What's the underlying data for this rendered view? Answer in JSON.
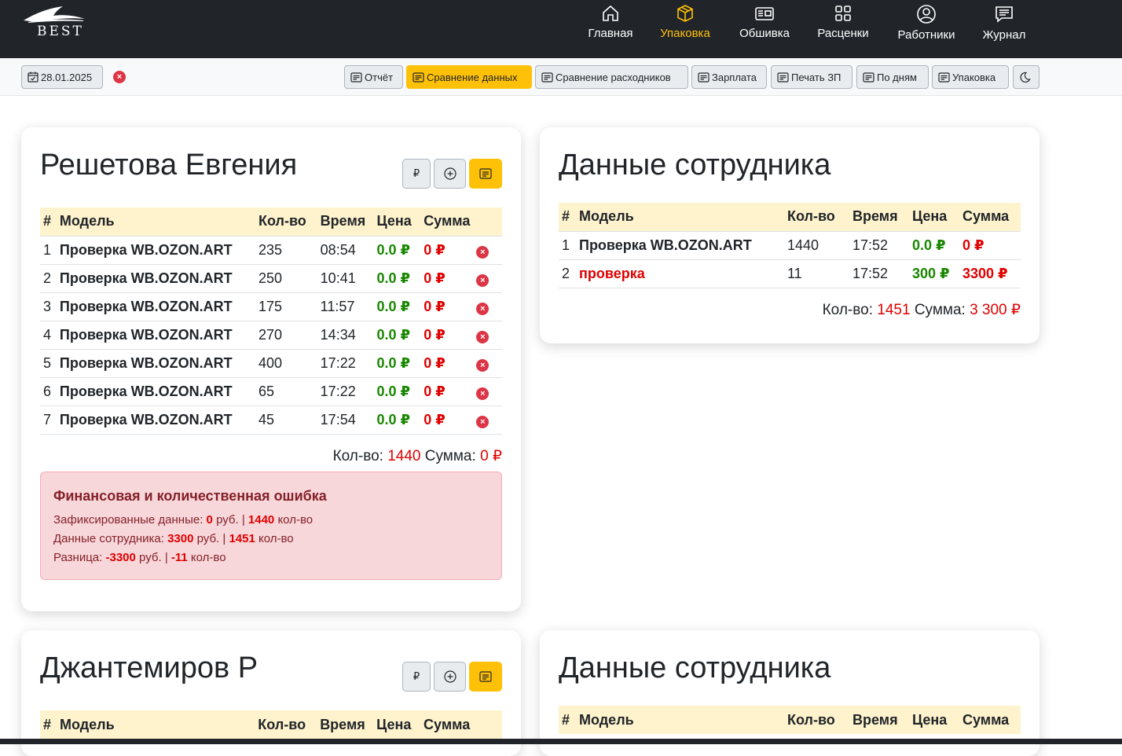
{
  "app": {
    "logo_text": "BEST"
  },
  "nav": [
    {
      "label": "Главная",
      "icon": "home-icon"
    },
    {
      "label": "Упаковка",
      "icon": "box-icon",
      "active": true
    },
    {
      "label": "Обшивка",
      "icon": "news-icon"
    },
    {
      "label": "Расценки",
      "icon": "grid-icon"
    },
    {
      "label": "Работники",
      "icon": "person-icon"
    },
    {
      "label": "Журнал",
      "icon": "journal-icon"
    }
  ],
  "toolbar": {
    "date": "28.01.2025",
    "buttons": [
      "Отчёт",
      "Сравнение данных",
      "Сравнение расходников",
      "Зарплата",
      "Печать ЗП",
      "По дням",
      "Упаковка"
    ],
    "active_button": "Сравнение данных"
  },
  "colors": {
    "accent": "#ffc107",
    "dark": "#212529",
    "green": "#198700",
    "red": "#e00000"
  },
  "cards": [
    {
      "title": "Решетова Евгения",
      "buttons": {
        "ruble": "₽"
      },
      "headers": [
        "#",
        "Модель",
        "Кол-во",
        "Время",
        "Цена",
        "Сумма"
      ],
      "rows": [
        {
          "n": "1",
          "model": "Проверка WB.OZON.ART",
          "qty": "235",
          "time": "08:54",
          "price": "0.0 ₽",
          "sum": "0 ₽"
        },
        {
          "n": "2",
          "model": "Проверка WB.OZON.ART",
          "qty": "250",
          "time": "10:41",
          "price": "0.0 ₽",
          "sum": "0 ₽"
        },
        {
          "n": "3",
          "model": "Проверка WB.OZON.ART",
          "qty": "175",
          "time": "11:57",
          "price": "0.0 ₽",
          "sum": "0 ₽"
        },
        {
          "n": "4",
          "model": "Проверка WB.OZON.ART",
          "qty": "270",
          "time": "14:34",
          "price": "0.0 ₽",
          "sum": "0 ₽"
        },
        {
          "n": "5",
          "model": "Проверка WB.OZON.ART",
          "qty": "400",
          "time": "17:22",
          "price": "0.0 ₽",
          "sum": "0 ₽"
        },
        {
          "n": "6",
          "model": "Проверка WB.OZON.ART",
          "qty": "65",
          "time": "17:22",
          "price": "0.0 ₽",
          "sum": "0 ₽"
        },
        {
          "n": "7",
          "model": "Проверка WB.OZON.ART",
          "qty": "45",
          "time": "17:54",
          "price": "0.0 ₽",
          "sum": "0 ₽"
        }
      ],
      "summary": {
        "qty_label": "Кол-во:",
        "qty": "1440",
        "sum_label": "Сумма:",
        "sum": "0 ₽"
      },
      "alert": {
        "title": "Финансовая и количественная ошибка",
        "line1": {
          "label": "Зафиксированные данные:",
          "money": "0",
          "money_unit": "руб. |",
          "qty": "1440",
          "qty_unit": "кол-во"
        },
        "line2": {
          "label": "Данные сотрудника:",
          "money": "3300",
          "money_unit": "руб. |",
          "qty": "1451",
          "qty_unit": "кол-во"
        },
        "line3": {
          "label": "Разница:",
          "money": "-3300",
          "money_unit": "руб. |",
          "qty": "-11",
          "qty_unit": "кол-во"
        }
      }
    },
    {
      "title": "Данные сотрудника",
      "headers": [
        "#",
        "Модель",
        "Кол-во",
        "Время",
        "Цена",
        "Сумма"
      ],
      "rows": [
        {
          "n": "1",
          "model": "Проверка WB.OZON.ART",
          "qty": "1440",
          "time": "17:52",
          "price": "0.0 ₽",
          "sum": "0 ₽"
        },
        {
          "n": "2",
          "model": "проверка",
          "qty": "11",
          "time": "17:52",
          "price": "300 ₽",
          "sum": "3300 ₽"
        }
      ],
      "summary": {
        "qty_label": "Кол-во:",
        "qty": "1451",
        "sum_label": "Сумма:",
        "sum": "3 300 ₽"
      }
    },
    {
      "title": "Джантемиров Р",
      "buttons": {
        "ruble": "₽"
      },
      "headers": [
        "#",
        "Модель",
        "Кол-во",
        "Время",
        "Цена",
        "Сумма"
      ]
    },
    {
      "title": "Данные сотрудника",
      "headers": [
        "#",
        "Модель",
        "Кол-во",
        "Время",
        "Цена",
        "Сумма"
      ]
    }
  ]
}
